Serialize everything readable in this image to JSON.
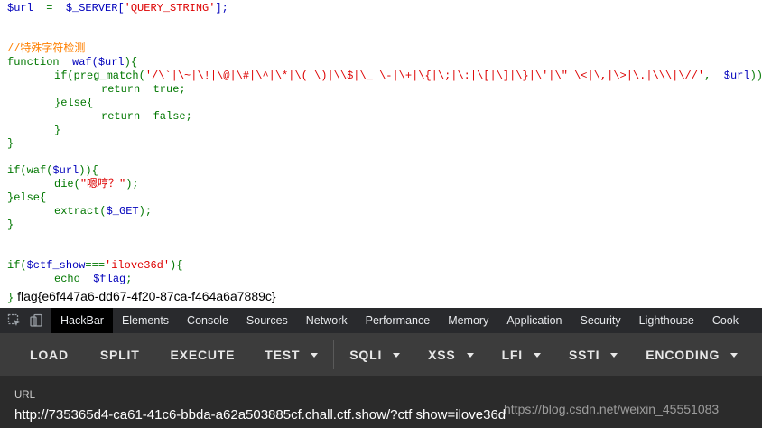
{
  "code": {
    "line1": {
      "var": "$url",
      "op": "  =  ",
      "fn": "$_SERVER[",
      "str": "'QUERY_STRING'",
      "end": "];"
    },
    "comment": "//特殊字符检测",
    "line_func": {
      "kw": "function",
      "name": "  waf(",
      "var": "$url",
      "end": "){"
    },
    "line_if": {
      "kw": "if(preg_match(",
      "str": "'/\\`|\\~|\\!|\\@|\\#|\\^|\\*|\\(|\\)|\\\\$|\\_|\\-|\\+|\\{|\\;|\\:|\\[|\\]|\\}|\\'|\\\"|\\<|\\,|\\>|\\.|\\\\\\|\\//'",
      "mid": ",  ",
      "var": "$url",
      "end": ")){"
    },
    "line_return_true": "return  true;",
    "line_else": "}else{",
    "line_return_false": "return  false;",
    "close1": "}",
    "close2": "}",
    "line_ifwaf": {
      "kw": "if(waf(",
      "var": "$url",
      "end": ")){"
    },
    "line_die": {
      "kw": "die(",
      "str": "\"嗯哼？\"",
      "end": ");"
    },
    "line_else2": "}else{",
    "line_extract": {
      "kw": "extract(",
      "var": "$_GET",
      "end": ");"
    },
    "close3": "}",
    "line_ifctf": {
      "kw": "if(",
      "var": "$ctf_show",
      "op": "===",
      "str": "'ilove36d'",
      "end": "){"
    },
    "line_echo": {
      "kw": "echo  ",
      "var": "$flag",
      "end": ";"
    },
    "close4": "}",
    "flag": "flag{e6f447a6-dd67-4f20-87ca-f464a6a7889c}"
  },
  "devtools": {
    "icons": [
      "inspect-cursor-icon",
      "device-toggle-icon"
    ],
    "tabs": [
      "HackBar",
      "Elements",
      "Console",
      "Sources",
      "Network",
      "Performance",
      "Memory",
      "Application",
      "Security",
      "Lighthouse",
      "Cook"
    ],
    "active_tab": "HackBar"
  },
  "hackbar": {
    "buttons": {
      "load": "LOAD",
      "split": "SPLIT",
      "execute": "EXECUTE",
      "test": "TEST",
      "sqli": "SQLI",
      "xss": "XSS",
      "lfi": "LFI",
      "ssti": "SSTI",
      "encoding": "ENCODING"
    },
    "url_label": "URL",
    "url_value": "http://735365d4-ca61-41c6-bbda-a62a503885cf.chall.ctf.show/?ctf show=ilove36d"
  },
  "watermark": "https://blog.csdn.net/weixin_45551083",
  "colors": {
    "keyword": "#007700",
    "variable": "#0000bb",
    "string": "#dd0000",
    "comment": "#ff8000",
    "devtools_bg": "#292a2d",
    "hackbar_bg": "#3c3c3c",
    "url_panel_bg": "#2b2b2b"
  }
}
